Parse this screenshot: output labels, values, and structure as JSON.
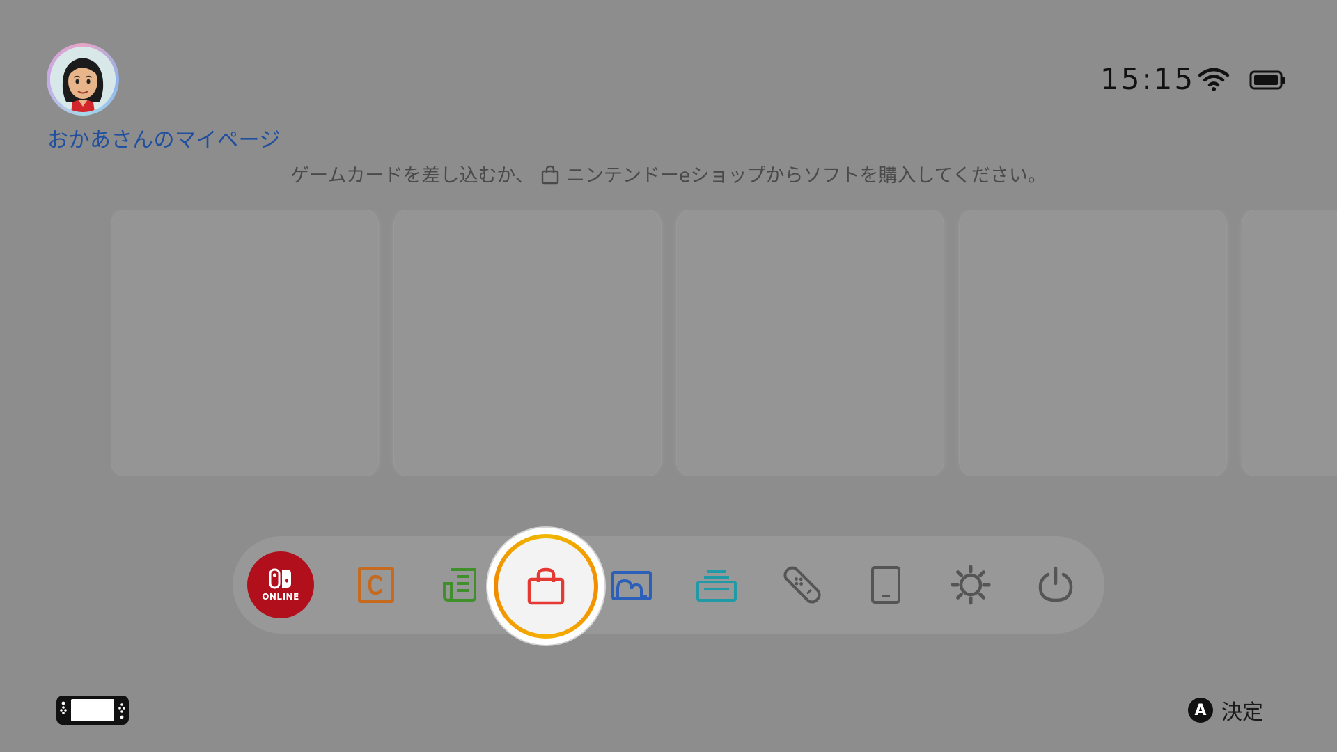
{
  "user": {
    "page_label": "おかあさんのマイページ"
  },
  "status": {
    "time": "15:15",
    "wifi_icon": "wifi-icon",
    "battery_icon": "battery-icon"
  },
  "message": {
    "before": "ゲームカードを差し込むか、",
    "after": "ニンテンドーeショップからソフトを購入してください。"
  },
  "tiles": {
    "count_visible": 5
  },
  "dock": {
    "items": [
      {
        "name": "nintendo-switch-online",
        "label": "ONLINE",
        "color": "#b20f1c"
      },
      {
        "name": "news",
        "icon": "c-news-icon",
        "color": "#c66a1f"
      },
      {
        "name": "catalog",
        "icon": "catalog-icon",
        "color": "#3f8f2a"
      },
      {
        "name": "nintendo-eshop",
        "icon": "shopping-bag-icon",
        "color": "#e53934",
        "selected": true
      },
      {
        "name": "album",
        "icon": "album-icon",
        "color": "#2c5fb8"
      },
      {
        "name": "virtual-game-cards",
        "icon": "card-stack-icon",
        "color": "#1f9aa6"
      },
      {
        "name": "controllers",
        "icon": "joycon-icon",
        "color": "#555555"
      },
      {
        "name": "sleep-mode-device",
        "icon": "tablet-icon",
        "color": "#555555"
      },
      {
        "name": "system-settings",
        "icon": "gear-icon",
        "color": "#555555"
      },
      {
        "name": "power",
        "icon": "power-icon",
        "color": "#555555"
      }
    ]
  },
  "bottom": {
    "console_icon": "switch-console-icon",
    "button": "A",
    "action_label": "決定"
  },
  "accent": {
    "focus_ring": "#f39200",
    "user_text": "#1f4f9e"
  }
}
